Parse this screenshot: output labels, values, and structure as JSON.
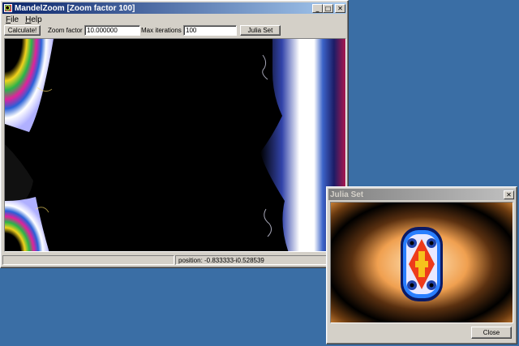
{
  "main_window": {
    "title": "MandelZoom [Zoom factor 100]",
    "controls": {
      "minimize": "_",
      "maximize": "□",
      "close": "✕"
    },
    "menu": [
      {
        "label": "File",
        "accel": "F"
      },
      {
        "label": "Help",
        "accel": "H"
      }
    ],
    "toolbar": {
      "calculate_label": "Calculate!",
      "zoom_label": "Zoom factor :",
      "zoom_value": "10.000000",
      "iterations_label": "Max iterations :",
      "iterations_value": "100",
      "julia_label": "Julia Set"
    },
    "status": {
      "position_text": "position: -0.833333-i0.528539"
    }
  },
  "julia_window": {
    "title": "Julia Set",
    "controls": {
      "close": "✕"
    },
    "close_button_label": "Close"
  },
  "icons": [
    "app-icon",
    "minimize-icon",
    "maximize-icon",
    "close-icon"
  ],
  "colors": {
    "desktop": "#3a6ea5",
    "active_title": "#0a246a",
    "inactive_title": "#808080",
    "window_face": "#d4d0c8"
  }
}
